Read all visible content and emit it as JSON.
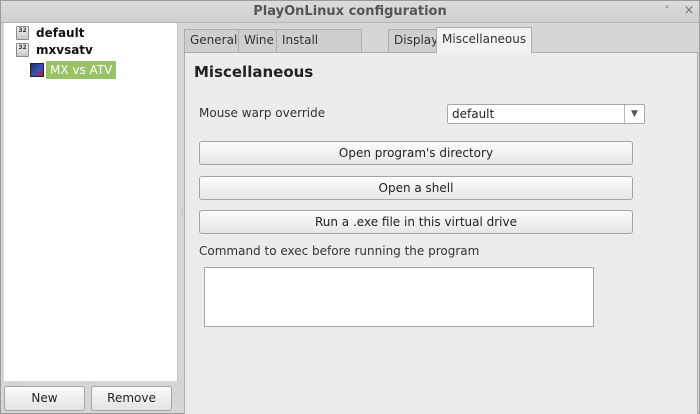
{
  "window": {
    "title": "PlayOnLinux configuration",
    "minimize_glyph": "˅",
    "close_glyph": "×"
  },
  "tree": {
    "items": [
      {
        "label": "default",
        "icon": "prefix-32-icon",
        "icon_text": "32"
      },
      {
        "label": "mxvsatv",
        "icon": "prefix-32-icon",
        "icon_text": "32"
      }
    ],
    "child": {
      "label": "MX vs ATV",
      "icon": "game-icon",
      "selected": true,
      "highlight_color": "#97c266"
    }
  },
  "bottom_buttons": {
    "new_label": "New",
    "remove_label": "Remove"
  },
  "tabs": [
    {
      "label": "General"
    },
    {
      "label": "Wine"
    },
    {
      "label": "Install components"
    },
    {
      "label": "Display"
    },
    {
      "label": "Miscellaneous",
      "active": true
    }
  ],
  "misc": {
    "heading": "Miscellaneous",
    "mouse_warp_label": "Mouse warp override",
    "mouse_warp_value": "default",
    "open_dir_label": "Open program's directory",
    "open_shell_label": "Open a shell",
    "run_exe_label": "Run a .exe file in this virtual drive",
    "command_label": "Command to exec before running the program",
    "command_value": ""
  }
}
